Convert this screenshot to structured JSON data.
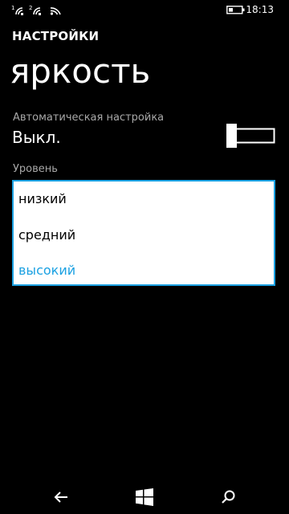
{
  "status_bar": {
    "time": "18:13",
    "sim1_label": "1",
    "sim2_label": "2",
    "icons": [
      "sim1-signal-icon",
      "sim2-signal-icon",
      "wifi-icon",
      "battery-icon"
    ]
  },
  "app_title": "НАСТРОЙКИ",
  "page_title": "яркость",
  "auto_setting": {
    "label": "Автоматическая настройка",
    "value": "Выкл.",
    "enabled": false
  },
  "level": {
    "label": "Уровень",
    "options": [
      "низкий",
      "средний",
      "высокий"
    ],
    "selected": "высокий"
  },
  "colors": {
    "accent": "#1ba1e2",
    "background": "#000000",
    "secondary_text": "#a8a8a8"
  },
  "nav_bar": {
    "icons": [
      "back-icon",
      "windows-start-icon",
      "search-icon"
    ]
  }
}
